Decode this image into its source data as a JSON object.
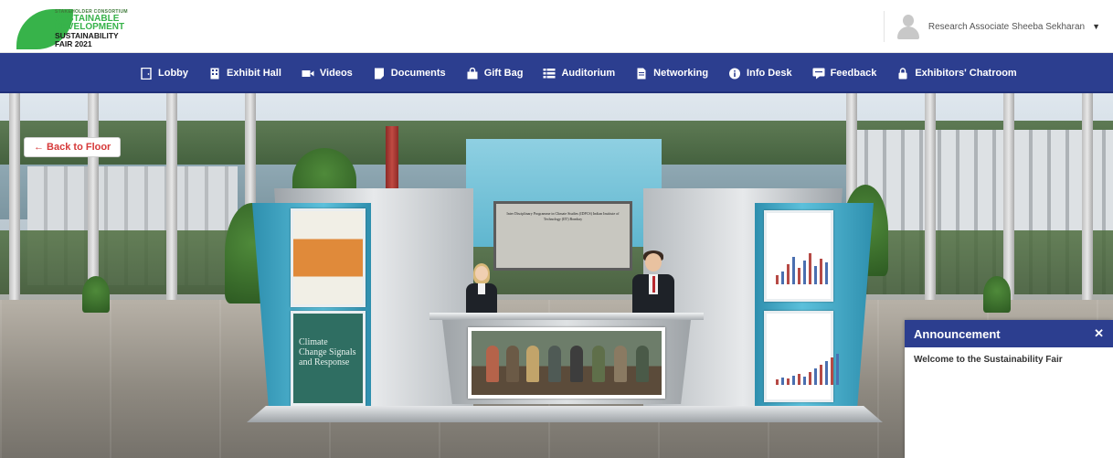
{
  "brand": {
    "logo_line1": "STAKEHOLDER CONSORTIUM",
    "logo_line2": "SUSTAINABLE",
    "logo_line3": "DEVELOPMENT",
    "logo_line4": "SUSTAINABILITY",
    "logo_line5": "FAIR 2021",
    "green": "#37b34a"
  },
  "user": {
    "name": "Research Associate Sheeba Sekharan",
    "avatar_icon": "user-avatar-icon",
    "caret_icon": "caret-down-icon"
  },
  "nav": {
    "color": "#2c3e8f",
    "items": [
      {
        "label": "Lobby",
        "icon": "door-icon"
      },
      {
        "label": "Exhibit Hall",
        "icon": "building-icon"
      },
      {
        "label": "Videos",
        "icon": "video-icon"
      },
      {
        "label": "Documents",
        "icon": "document-icon"
      },
      {
        "label": "Gift Bag",
        "icon": "bag-icon"
      },
      {
        "label": "Auditorium",
        "icon": "list-icon"
      },
      {
        "label": "Networking",
        "icon": "file-icon"
      },
      {
        "label": "Info Desk",
        "icon": "info-icon"
      },
      {
        "label": "Feedback",
        "icon": "feedback-icon"
      },
      {
        "label": "Exhibitors' Chatroom",
        "icon": "lock-icon"
      }
    ]
  },
  "scene": {
    "back_button": "← Back to Floor",
    "poster_book_title": "Climate Change Signals and Response",
    "screen_title": "Inter Disciplinary Programme in Climate Studies (IDPCS) Indian Institute of Technology (IIT) Bombay"
  },
  "announcement": {
    "title": "Announcement",
    "close_icon": "close-icon",
    "message": "Welcome to the Sustainability Fair"
  }
}
